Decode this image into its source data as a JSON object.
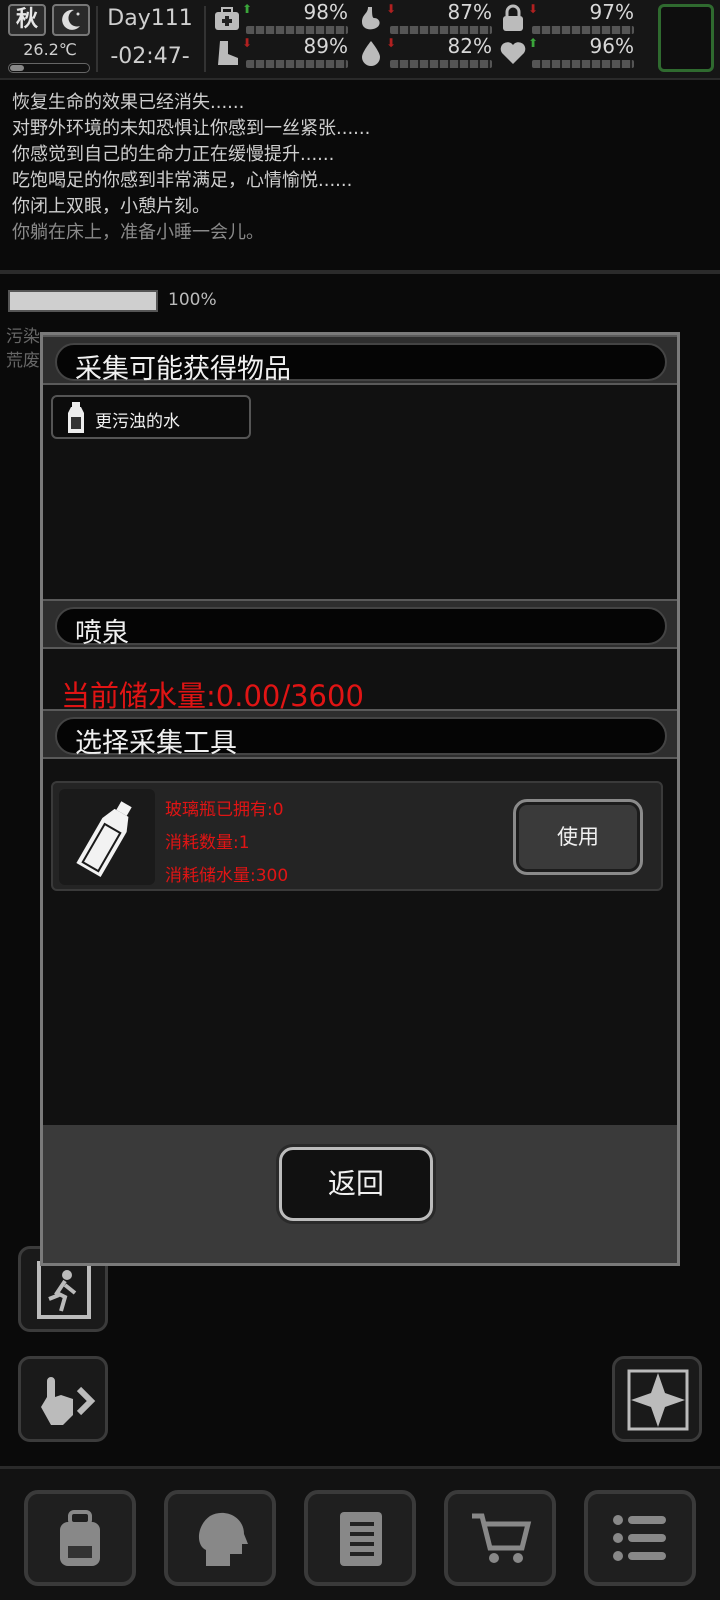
{
  "hud": {
    "season": "秋",
    "temperature": "26.2℃",
    "day": "Day111",
    "clock": "-02:47-",
    "stats": [
      {
        "icon": "medkit-icon",
        "trend": "up",
        "value": "98%",
        "level": 0.98
      },
      {
        "icon": "stomach-icon",
        "trend": "down",
        "value": "87%",
        "level": 0.87
      },
      {
        "icon": "lock-icon",
        "trend": "down",
        "value": "97%",
        "level": 0.97
      },
      {
        "icon": "boot-icon",
        "trend": "down",
        "value": "89%",
        "level": 0.89
      },
      {
        "icon": "water-drop-icon",
        "trend": "down",
        "value": "82%",
        "level": 0.82
      },
      {
        "icon": "heart-icon",
        "trend": "up",
        "value": "96%",
        "level": 0.96
      }
    ]
  },
  "log": {
    "lines": [
      "恢复生命的效果已经消失......",
      "对野外环境的未知恐惧让你感到一丝紧张......",
      "你感觉到自己的生命力正在缓慢提升......",
      "吃饱喝足的你感到非常满足，心情愉悦......",
      "你闭上双眼，小憩片刻。",
      "你躺在床上，准备小睡一会儿。"
    ]
  },
  "progress": {
    "value": "100%"
  },
  "background_labels": [
    "污染",
    "荒废"
  ],
  "modal": {
    "items_header": "采集可能获得物品",
    "item": {
      "icon": "bottle-icon",
      "label": "更污浊的水"
    },
    "source_header": "喷泉",
    "water_status": "当前储水量:0.00/3600",
    "tool_header": "选择采集工具",
    "tool": {
      "icon": "glass-bottle-icon",
      "owned": "玻璃瓶已拥有:0",
      "consume_count": "消耗数量:1",
      "consume_water": "消耗储水量:300",
      "use_label": "使用"
    },
    "back_label": "返回"
  },
  "colors": {
    "warning_red": "#e01414",
    "panel_bg": "#111111",
    "accent_green": "#2f6a2f"
  }
}
